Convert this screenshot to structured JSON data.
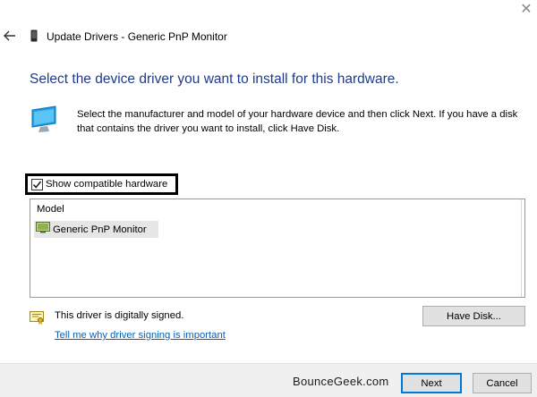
{
  "window": {
    "title": "Update Drivers - Generic PnP Monitor",
    "close_glyph": "✕",
    "back_icon": "back-arrow-icon",
    "title_icon": "device-icon"
  },
  "main": {
    "heading": "Select the device driver you want to install for this hardware.",
    "instructions": "Select the manufacturer and model of your hardware device and then click Next. If you have a disk that contains the driver you want to install, click Have Disk.",
    "hardware_icon": "monitor-icon",
    "compatible_checkbox": {
      "label": "Show compatible hardware",
      "checked": true
    },
    "model_list": {
      "header": "Model",
      "items": [
        {
          "label": "Generic PnP Monitor",
          "selected": true,
          "icon": "monitor-small-icon"
        }
      ]
    },
    "signing": {
      "status": "This driver is digitally signed.",
      "icon": "certificate-icon",
      "link": "Tell me why driver signing is important"
    },
    "have_disk_label": "Have Disk..."
  },
  "footer": {
    "watermark": "BounceGeek.com",
    "next_label": "Next",
    "cancel_label": "Cancel"
  },
  "colors": {
    "heading": "#1e3a8a",
    "link": "#0a5fb4",
    "accent": "#0078d7",
    "selection": "#e6e6e6",
    "footer_bg": "#f0f0f0"
  }
}
